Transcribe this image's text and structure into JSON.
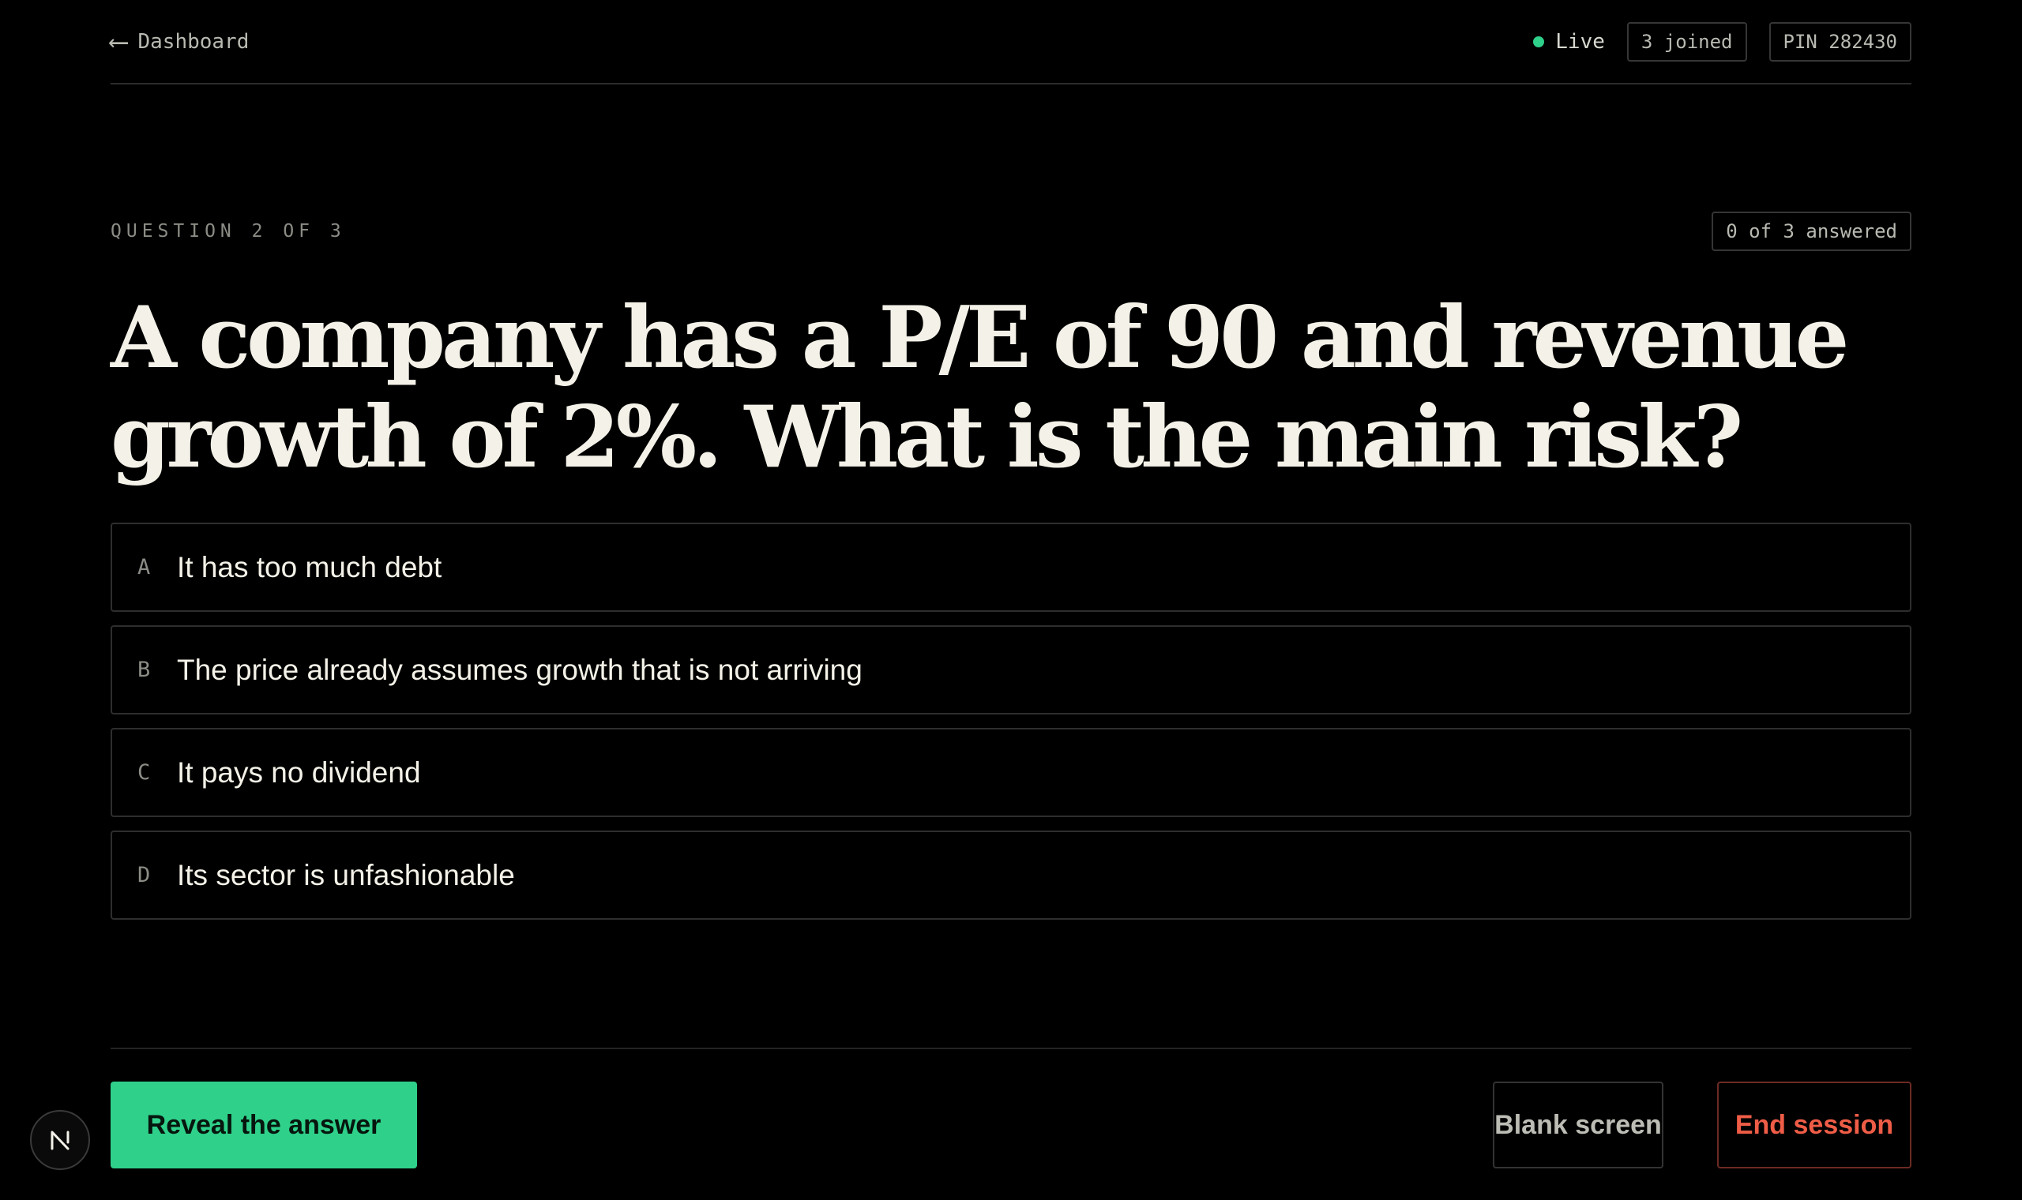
{
  "nav": {
    "back_arrow": "⟵",
    "back_label": "Dashboard"
  },
  "status": {
    "live_label": "Live",
    "joined": "3 joined",
    "pin": "PIN 282430"
  },
  "question": {
    "counter": "QUESTION 2 OF 3",
    "answered": "0 of 3 answered",
    "text": "A company has a P/E of 90 and revenue growth of 2%. What is the main risk?"
  },
  "options": [
    {
      "letter": "A",
      "text": "It has too much debt"
    },
    {
      "letter": "B",
      "text": "The price already assumes growth that is not arriving"
    },
    {
      "letter": "C",
      "text": "It pays no dividend"
    },
    {
      "letter": "D",
      "text": "Its sector is unfashionable"
    }
  ],
  "actions": {
    "reveal": "Reveal the answer",
    "blank": "Blank screen",
    "end": "End session"
  },
  "icons": {
    "back": "arrow-left-icon",
    "live": "live-dot-icon",
    "corner": "n-logo-icon"
  },
  "colors": {
    "accent_green": "#2fd08a",
    "danger_red": "#ef5d47",
    "background": "#000000",
    "text_primary": "#f4f2e8"
  }
}
